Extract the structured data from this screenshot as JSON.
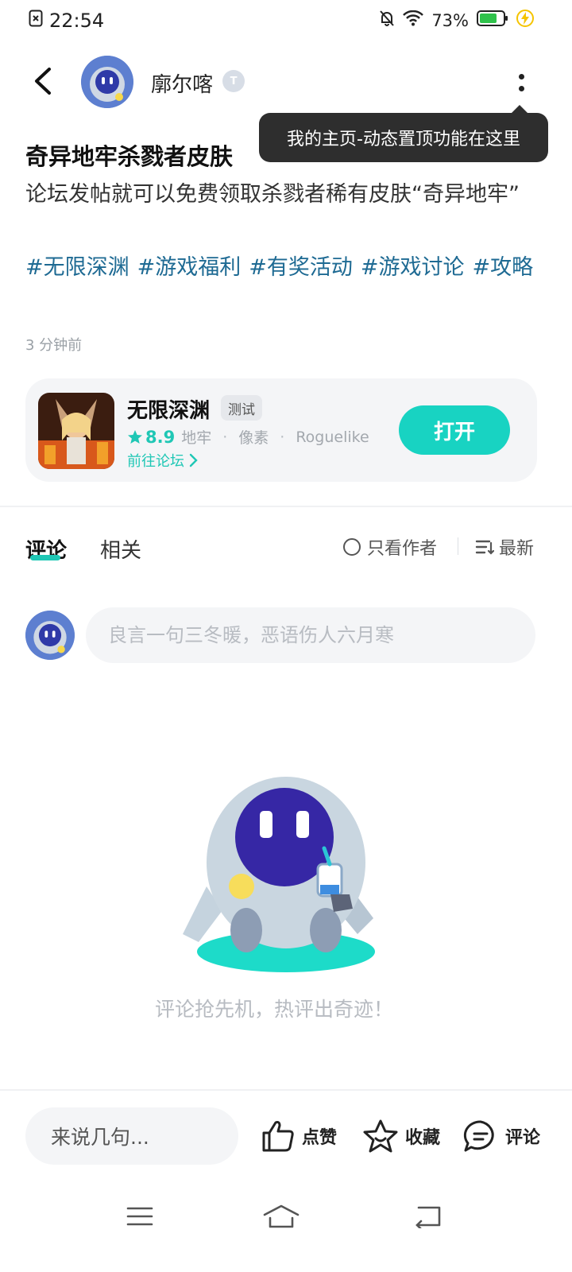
{
  "status_bar": {
    "time": "22:54",
    "battery": "73%"
  },
  "header": {
    "author": "廓尔喀",
    "badge": "T"
  },
  "tooltip": "我的主页-动态置顶功能在这里",
  "post": {
    "title": "奇异地牢杀戮者皮肤",
    "body": "论坛发帖就可以免费领取杀戮者稀有皮肤“奇异地牢”",
    "tags": [
      "#无限深渊",
      "#游戏福利",
      "#有奖活动",
      "#游戏讨论",
      "#攻略"
    ],
    "time": "3 分钟前"
  },
  "game_card": {
    "name": "无限深渊",
    "badge": "测试",
    "rating": "8.9",
    "genres": [
      "地牢",
      "像素",
      "Roguelike"
    ],
    "forum_link": "前往论坛",
    "open_label": "打开"
  },
  "tabs": {
    "comments": "评论",
    "related": "相关"
  },
  "filters": {
    "author_only": "只看作者",
    "sort": "最新"
  },
  "comment_box": {
    "placeholder": "良言一句三冬暖，恶语伤人六月寒"
  },
  "empty_state": {
    "text": "评论抢先机，热评出奇迹！"
  },
  "bottom_bar": {
    "input_placeholder": "来说几句...",
    "like_label": "点赞",
    "favorite_label": "收藏",
    "comment_label": "评论"
  },
  "colors": {
    "accent": "#18d3c2",
    "tag": "#1e6a93",
    "tooltip_bg": "#2e2e2e"
  }
}
